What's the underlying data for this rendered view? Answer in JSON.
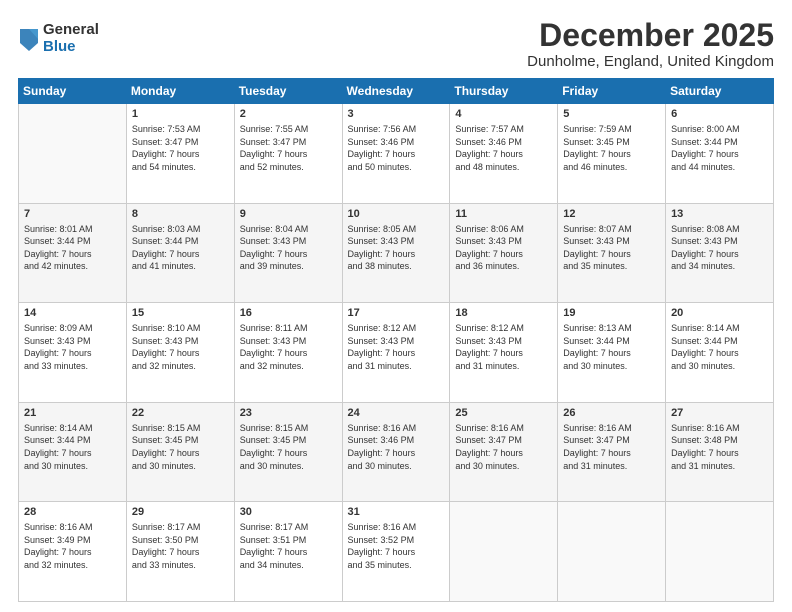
{
  "header": {
    "logo_general": "General",
    "logo_blue": "Blue",
    "title": "December 2025",
    "subtitle": "Dunholme, England, United Kingdom"
  },
  "calendar": {
    "days_header": [
      "Sunday",
      "Monday",
      "Tuesday",
      "Wednesday",
      "Thursday",
      "Friday",
      "Saturday"
    ],
    "weeks": [
      {
        "shade": false,
        "days": [
          {
            "num": "",
            "info": ""
          },
          {
            "num": "1",
            "info": "Sunrise: 7:53 AM\nSunset: 3:47 PM\nDaylight: 7 hours\nand 54 minutes."
          },
          {
            "num": "2",
            "info": "Sunrise: 7:55 AM\nSunset: 3:47 PM\nDaylight: 7 hours\nand 52 minutes."
          },
          {
            "num": "3",
            "info": "Sunrise: 7:56 AM\nSunset: 3:46 PM\nDaylight: 7 hours\nand 50 minutes."
          },
          {
            "num": "4",
            "info": "Sunrise: 7:57 AM\nSunset: 3:46 PM\nDaylight: 7 hours\nand 48 minutes."
          },
          {
            "num": "5",
            "info": "Sunrise: 7:59 AM\nSunset: 3:45 PM\nDaylight: 7 hours\nand 46 minutes."
          },
          {
            "num": "6",
            "info": "Sunrise: 8:00 AM\nSunset: 3:44 PM\nDaylight: 7 hours\nand 44 minutes."
          }
        ]
      },
      {
        "shade": true,
        "days": [
          {
            "num": "7",
            "info": "Sunrise: 8:01 AM\nSunset: 3:44 PM\nDaylight: 7 hours\nand 42 minutes."
          },
          {
            "num": "8",
            "info": "Sunrise: 8:03 AM\nSunset: 3:44 PM\nDaylight: 7 hours\nand 41 minutes."
          },
          {
            "num": "9",
            "info": "Sunrise: 8:04 AM\nSunset: 3:43 PM\nDaylight: 7 hours\nand 39 minutes."
          },
          {
            "num": "10",
            "info": "Sunrise: 8:05 AM\nSunset: 3:43 PM\nDaylight: 7 hours\nand 38 minutes."
          },
          {
            "num": "11",
            "info": "Sunrise: 8:06 AM\nSunset: 3:43 PM\nDaylight: 7 hours\nand 36 minutes."
          },
          {
            "num": "12",
            "info": "Sunrise: 8:07 AM\nSunset: 3:43 PM\nDaylight: 7 hours\nand 35 minutes."
          },
          {
            "num": "13",
            "info": "Sunrise: 8:08 AM\nSunset: 3:43 PM\nDaylight: 7 hours\nand 34 minutes."
          }
        ]
      },
      {
        "shade": false,
        "days": [
          {
            "num": "14",
            "info": "Sunrise: 8:09 AM\nSunset: 3:43 PM\nDaylight: 7 hours\nand 33 minutes."
          },
          {
            "num": "15",
            "info": "Sunrise: 8:10 AM\nSunset: 3:43 PM\nDaylight: 7 hours\nand 32 minutes."
          },
          {
            "num": "16",
            "info": "Sunrise: 8:11 AM\nSunset: 3:43 PM\nDaylight: 7 hours\nand 32 minutes."
          },
          {
            "num": "17",
            "info": "Sunrise: 8:12 AM\nSunset: 3:43 PM\nDaylight: 7 hours\nand 31 minutes."
          },
          {
            "num": "18",
            "info": "Sunrise: 8:12 AM\nSunset: 3:43 PM\nDaylight: 7 hours\nand 31 minutes."
          },
          {
            "num": "19",
            "info": "Sunrise: 8:13 AM\nSunset: 3:44 PM\nDaylight: 7 hours\nand 30 minutes."
          },
          {
            "num": "20",
            "info": "Sunrise: 8:14 AM\nSunset: 3:44 PM\nDaylight: 7 hours\nand 30 minutes."
          }
        ]
      },
      {
        "shade": true,
        "days": [
          {
            "num": "21",
            "info": "Sunrise: 8:14 AM\nSunset: 3:44 PM\nDaylight: 7 hours\nand 30 minutes."
          },
          {
            "num": "22",
            "info": "Sunrise: 8:15 AM\nSunset: 3:45 PM\nDaylight: 7 hours\nand 30 minutes."
          },
          {
            "num": "23",
            "info": "Sunrise: 8:15 AM\nSunset: 3:45 PM\nDaylight: 7 hours\nand 30 minutes."
          },
          {
            "num": "24",
            "info": "Sunrise: 8:16 AM\nSunset: 3:46 PM\nDaylight: 7 hours\nand 30 minutes."
          },
          {
            "num": "25",
            "info": "Sunrise: 8:16 AM\nSunset: 3:47 PM\nDaylight: 7 hours\nand 30 minutes."
          },
          {
            "num": "26",
            "info": "Sunrise: 8:16 AM\nSunset: 3:47 PM\nDaylight: 7 hours\nand 31 minutes."
          },
          {
            "num": "27",
            "info": "Sunrise: 8:16 AM\nSunset: 3:48 PM\nDaylight: 7 hours\nand 31 minutes."
          }
        ]
      },
      {
        "shade": false,
        "days": [
          {
            "num": "28",
            "info": "Sunrise: 8:16 AM\nSunset: 3:49 PM\nDaylight: 7 hours\nand 32 minutes."
          },
          {
            "num": "29",
            "info": "Sunrise: 8:17 AM\nSunset: 3:50 PM\nDaylight: 7 hours\nand 33 minutes."
          },
          {
            "num": "30",
            "info": "Sunrise: 8:17 AM\nSunset: 3:51 PM\nDaylight: 7 hours\nand 34 minutes."
          },
          {
            "num": "31",
            "info": "Sunrise: 8:16 AM\nSunset: 3:52 PM\nDaylight: 7 hours\nand 35 minutes."
          },
          {
            "num": "",
            "info": ""
          },
          {
            "num": "",
            "info": ""
          },
          {
            "num": "",
            "info": ""
          }
        ]
      }
    ]
  }
}
